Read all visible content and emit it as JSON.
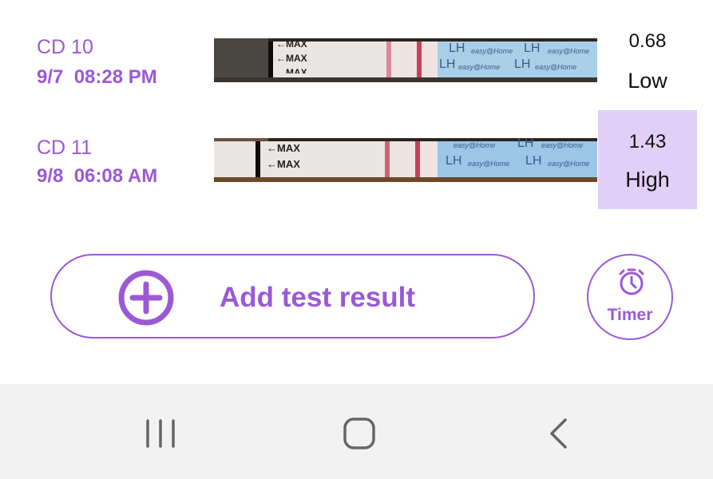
{
  "entries": [
    {
      "cycle_day": "CD 10",
      "datetime": "9/7  08:28 PM",
      "value": "0.68",
      "level": "Low",
      "strip_text": {
        "max1": "←MAX",
        "max2": "←MAX",
        "max3": "←MAX",
        "lh": "LH",
        "brand": "easy@Home"
      }
    },
    {
      "cycle_day": "CD 11",
      "datetime": "9/8  06:08 AM",
      "value": "1.43",
      "level": "High",
      "strip_text": {
        "max1": "←MAX",
        "max2": "←MAX",
        "lh": "LH",
        "brand": "easy@Home"
      }
    }
  ],
  "actions": {
    "add_label": "Add test result",
    "timer_label": "Timer"
  },
  "icons": {
    "add": "plus-circle-icon",
    "timer": "stopwatch-icon",
    "recent": "recent-apps-icon",
    "home": "home-icon",
    "back": "back-icon"
  },
  "colors": {
    "accent": "#9b59d6",
    "high_highlight": "#e2cff7",
    "navbar": "#f2f2f2"
  }
}
